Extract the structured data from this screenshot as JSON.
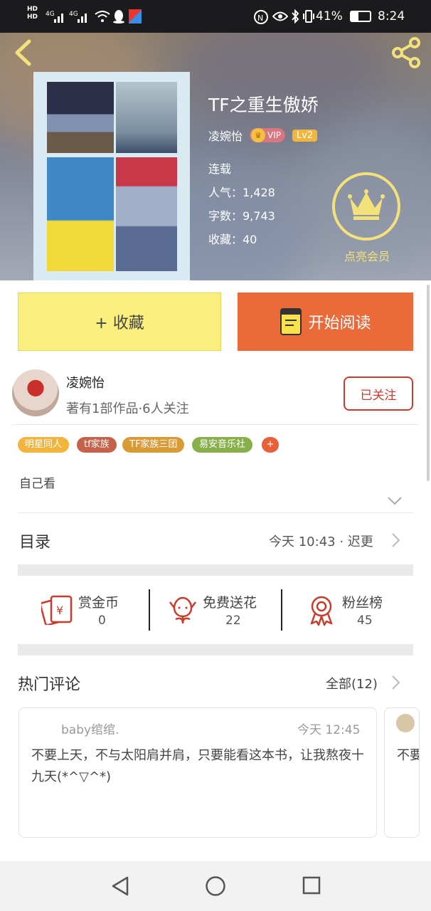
{
  "status_bar": {
    "left_icons": [
      "hd-icon",
      "4g-signal-icon",
      "4g-signal-icon",
      "wifi-icon",
      "qq-icon",
      "app-icon"
    ],
    "right_icons": [
      "nfc-icon",
      "eye-icon",
      "bluetooth-icon",
      "vibrate-icon"
    ],
    "battery": "41%",
    "time": "8:24"
  },
  "header": {
    "back_icon": "chevron-left-icon",
    "share_icon": "share-icon"
  },
  "book": {
    "title": "TF之重生傲娇",
    "author": "凌婉怡",
    "vip_label": "VIP",
    "level": "Lv2",
    "status": "连载",
    "popularity": "人气：1,428",
    "word_count": "字数：9,743",
    "favorites": "收藏：40"
  },
  "member": {
    "label": "点亮会员"
  },
  "actions": {
    "favorite": "+ 收藏",
    "read": "开始阅读"
  },
  "author": {
    "name": "凌婉怡",
    "stats": "著有1部作品·6人关注",
    "follow": "已关注"
  },
  "tags": [
    {
      "label": "明星同人",
      "color": "#f3b43c"
    },
    {
      "label": "tf家族",
      "color": "#c5624b"
    },
    {
      "label": "TF家族三团",
      "color": "#d89b38"
    },
    {
      "label": "易安音乐社",
      "color": "#88b04a"
    },
    {
      "label": "+",
      "color": "#e8603a"
    }
  ],
  "description": "自己看",
  "toc": {
    "title": "目录",
    "info": "今天 10:43 · 迟更"
  },
  "stats": [
    {
      "label": "赏金币",
      "value": "0",
      "icon": "reward-coin-icon"
    },
    {
      "label": "免费送花",
      "value": "22",
      "icon": "flower-icon"
    },
    {
      "label": "粉丝榜",
      "value": "45",
      "icon": "medal-icon"
    }
  ],
  "comments": {
    "title": "热门评论",
    "all": "全部(12)",
    "items": [
      {
        "user": "baby绾绾.",
        "time": "今天 12:45",
        "text": "不要上天，不与太阳肩并肩，只要能看这本书，让我熬夜十九天(*^▽^*)"
      },
      {
        "text": "不要"
      }
    ]
  },
  "colors": {
    "accent": "#ea6a3a",
    "favorite_bg": "#fbf07e",
    "member_gold": "#f3e27a",
    "follow_red": "#c83c2c"
  }
}
